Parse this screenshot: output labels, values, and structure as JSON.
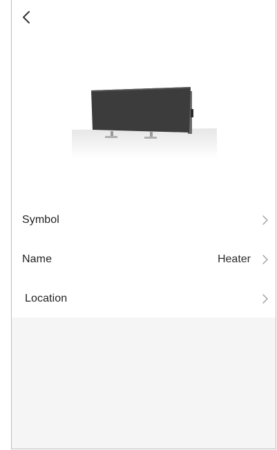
{
  "header": {
    "back_icon": "chevron-left-icon"
  },
  "product": {
    "image_icon": "panel-heater-image"
  },
  "settings": {
    "rows": [
      {
        "label": "Symbol",
        "value": "",
        "icon": "chevron-right-icon"
      },
      {
        "label": "Name",
        "value": "Heater",
        "icon": "chevron-right-icon"
      },
      {
        "label": "Location",
        "value": "",
        "icon": "chevron-right-icon"
      }
    ]
  },
  "colors": {
    "background": "#ffffff",
    "footer_background": "#f5f5f5",
    "text": "#1f1f1f",
    "chevron": "#9e9e9e",
    "border": "#bdbdbd"
  }
}
